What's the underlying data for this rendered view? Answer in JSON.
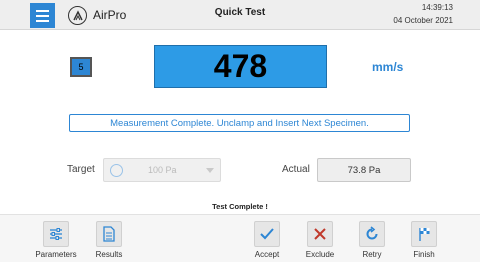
{
  "header": {
    "brand": "AirPro",
    "title": "Quick Test",
    "time": "14:39:13",
    "date": "04 October 2021"
  },
  "main": {
    "index": "5",
    "value": "478",
    "unit": "mm/s",
    "message": "Measurement Complete. Unclamp and Insert Next Specimen.",
    "target_label": "Target",
    "target_value": "100 Pa",
    "actual_label": "Actual",
    "actual_value": "73.8 Pa"
  },
  "status": "Test Complete !",
  "toolbar": {
    "parameters": "Parameters",
    "results": "Results",
    "accept": "Accept",
    "exclude": "Exclude",
    "retry": "Retry",
    "finish": "Finish"
  },
  "colors": {
    "accent": "#2d86d4",
    "value_box": "#2d9be6",
    "accept": "#2d86d4",
    "exclude": "#c0392b"
  },
  "icons": [
    "menu-icon",
    "airpro-logo-icon",
    "target-gauge-icon",
    "sliders-icon",
    "document-icon",
    "check-icon",
    "x-icon",
    "retry-icon",
    "flag-icon"
  ]
}
